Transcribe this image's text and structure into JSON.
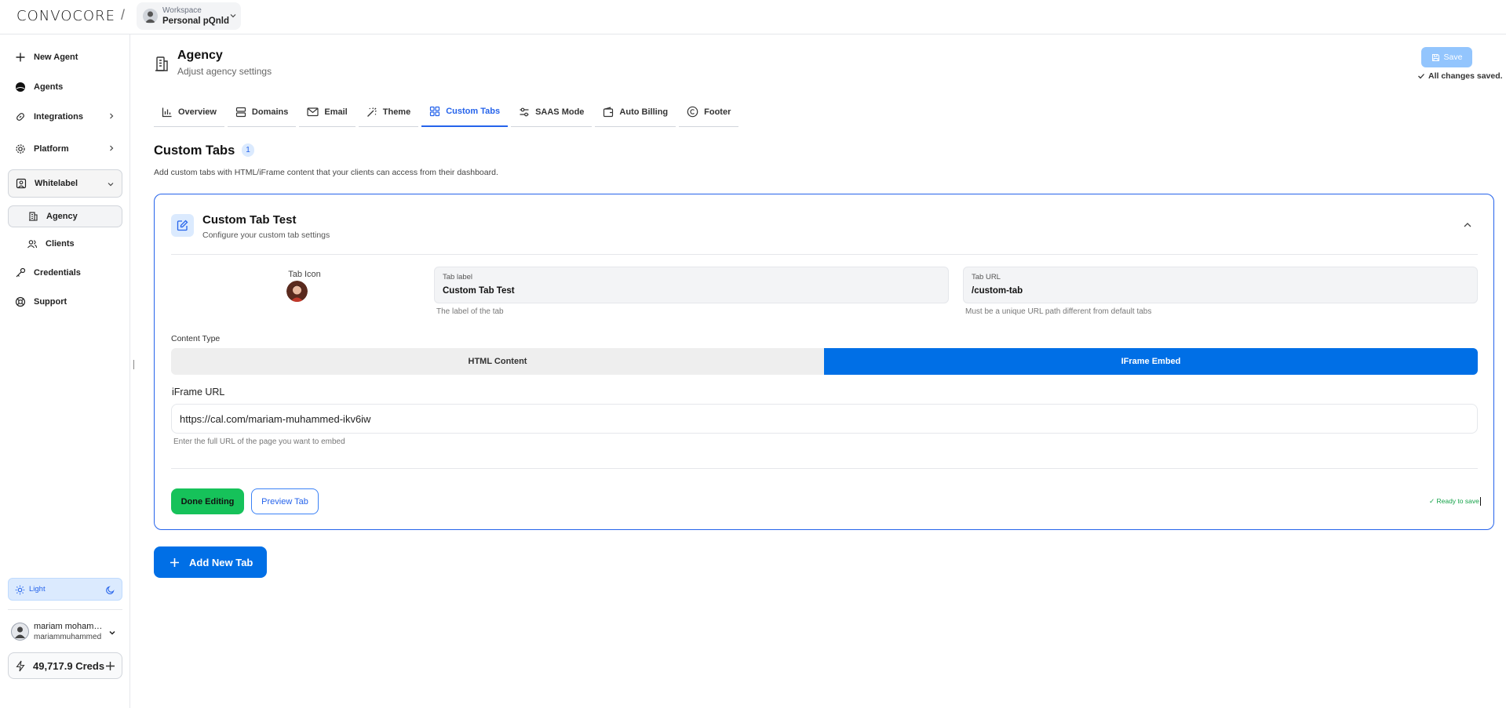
{
  "header": {
    "logo_text": "CONVOCORE",
    "separator": "/",
    "workspace_caption": "Workspace",
    "workspace_name": "Personal pQnld"
  },
  "sidebar": {
    "items": [
      {
        "label": "New Agent",
        "icon": "plus-icon"
      },
      {
        "label": "Agents",
        "icon": "agent-icon"
      },
      {
        "label": "Integrations",
        "icon": "link-icon"
      },
      {
        "label": "Platform",
        "icon": "gear-icon"
      },
      {
        "label": "Whitelabel",
        "icon": "user-badge-icon"
      },
      {
        "label": "Agency",
        "icon": "building-icon"
      },
      {
        "label": "Clients",
        "icon": "users-icon"
      },
      {
        "label": "Credentials",
        "icon": "key-icon"
      },
      {
        "label": "Support",
        "icon": "lifebuoy-icon"
      }
    ],
    "theme_label": "Light",
    "user_name": "mariam mohammed",
    "user_email": "mariammuhammed",
    "credits": "49,717.9 Creds"
  },
  "page": {
    "title": "Agency",
    "subtitle": "Adjust agency settings",
    "save_label": "Save",
    "saved_status": "All changes saved."
  },
  "tabs": [
    {
      "label": "Overview",
      "icon": "bar-chart-icon"
    },
    {
      "label": "Domains",
      "icon": "server-icon"
    },
    {
      "label": "Email",
      "icon": "mail-icon"
    },
    {
      "label": "Theme",
      "icon": "wand-icon"
    },
    {
      "label": "Custom Tabs",
      "icon": "layout-icon",
      "active": true
    },
    {
      "label": "SAAS Mode",
      "icon": "sliders-icon"
    },
    {
      "label": "Auto Billing",
      "icon": "wallet-icon"
    },
    {
      "label": "Footer",
      "icon": "copyright-icon"
    }
  ],
  "section": {
    "title": "Custom Tabs",
    "count": "1",
    "description": "Add custom tabs with HTML/iFrame content that your clients can access from their dashboard."
  },
  "card": {
    "title": "Custom Tab Test",
    "subtitle": "Configure your custom tab settings",
    "tab_icon_label": "Tab Icon",
    "tab_label_caption": "Tab label",
    "tab_label_value": "Custom Tab Test",
    "tab_label_help": "The label of the tab",
    "tab_url_caption": "Tab URL",
    "tab_url_value": "/custom-tab",
    "tab_url_help": "Must be a unique URL path different from default tabs",
    "content_type_label": "Content Type",
    "content_type_options": [
      "HTML Content",
      "IFrame Embed"
    ],
    "content_type_selected": "IFrame Embed",
    "iframe_label": "iFrame URL",
    "iframe_value": "https://cal.com/mariam-muhammed-ikv6iw",
    "iframe_help": "Enter the full URL of the page you want to embed",
    "done_label": "Done Editing",
    "preview_label": "Preview Tab",
    "ready_status": "✓ Ready to save"
  },
  "add_tab_label": "Add New Tab",
  "colors": {
    "accent": "#006fe6",
    "success": "#16c25a",
    "save_disabled": "#93c5fd"
  }
}
